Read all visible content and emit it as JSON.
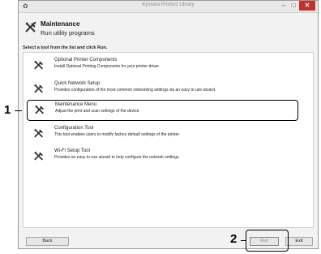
{
  "window": {
    "app_icon": "app-icon",
    "title": "Kyocera Product Library",
    "controls": {
      "minimize": "–",
      "maximize": "□",
      "close": "✕"
    }
  },
  "header": {
    "icon": "wrench-hammer-icon",
    "title": "Maintenance",
    "subtitle": "Run utility programs"
  },
  "instruction": "Select a tool from the list and click Run.",
  "tools": [
    {
      "title": "Optional Printer Components",
      "description": "Install Optional Printing Components for your printer driver.",
      "selected": false
    },
    {
      "title": "Quick Network Setup",
      "description": "Provides configuration of the most common networking settings via an easy to use wizard.",
      "selected": false
    },
    {
      "title": "Maintenance Menu",
      "description": "Adjust the print and scan settings of the device.",
      "selected": true
    },
    {
      "title": "Configuration Tool",
      "description": "This tool enables users to modify factory default settings of the printer.",
      "selected": false
    },
    {
      "title": "Wi-Fi Setup Tool",
      "description": "Provides an easy to use wizard to help configure the network settings.",
      "selected": false
    }
  ],
  "buttons": {
    "back": "Back",
    "run": "Run",
    "exit": "Exit"
  },
  "callouts": {
    "one": "1",
    "two": "2"
  }
}
